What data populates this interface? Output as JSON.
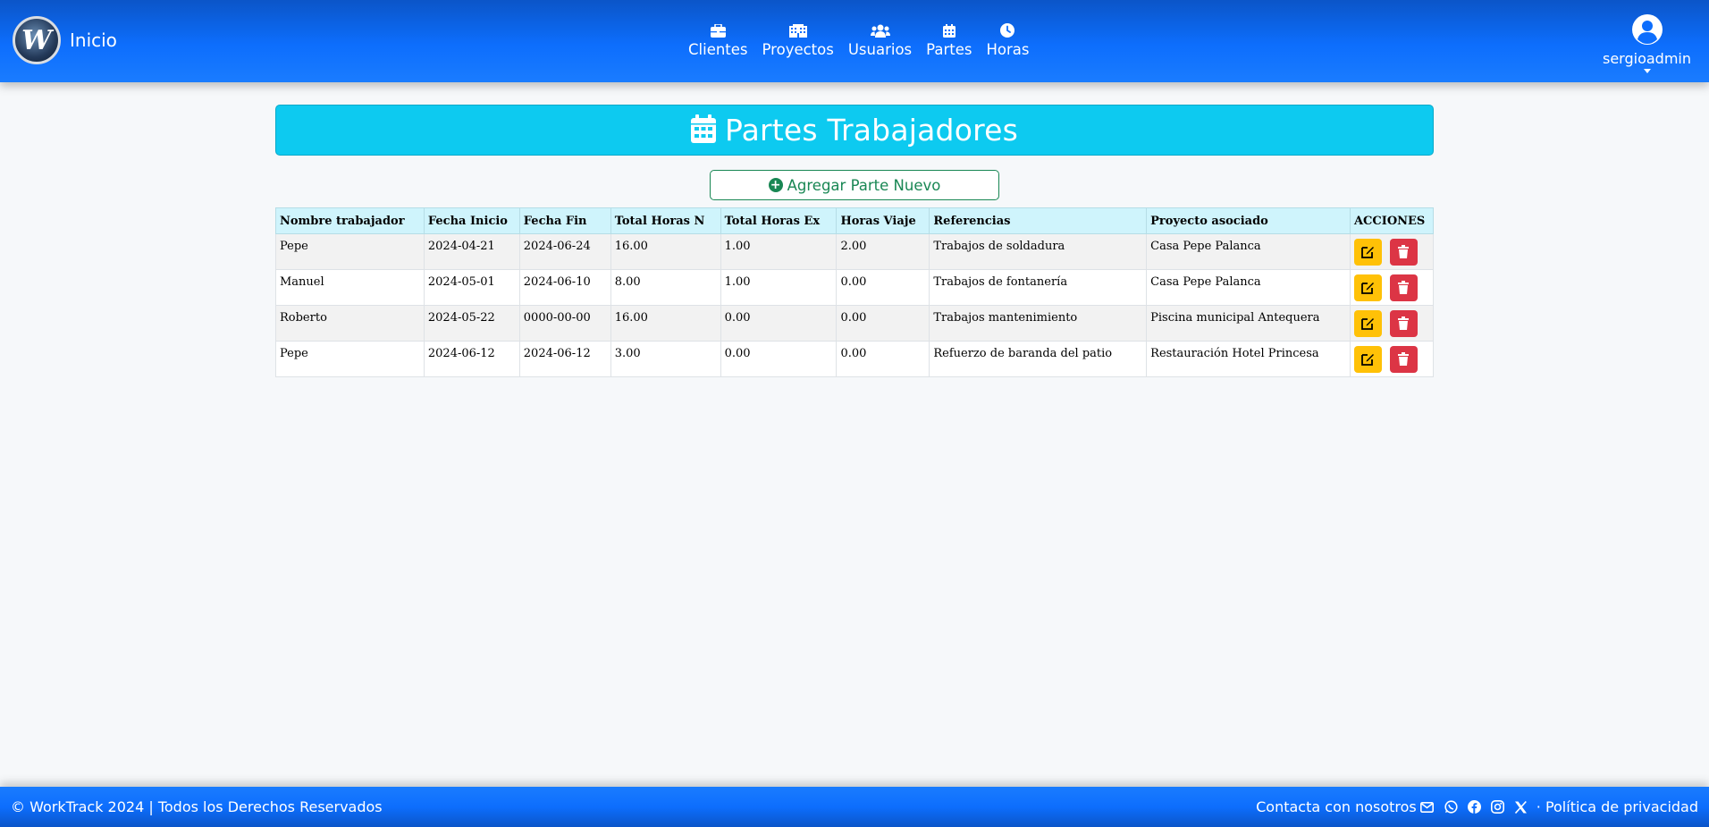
{
  "header": {
    "brand_label": "Inicio",
    "logo_letter": "W",
    "nav": [
      {
        "label": "Clientes",
        "icon": "briefcase-icon"
      },
      {
        "label": "Proyectos",
        "icon": "building-icon"
      },
      {
        "label": "Usuarios",
        "icon": "users-icon"
      },
      {
        "label": "Partes",
        "icon": "calendar-icon"
      },
      {
        "label": "Horas",
        "icon": "clock-icon"
      }
    ],
    "user": {
      "name": "sergioadmin",
      "icon": "user-circle-icon"
    }
  },
  "page": {
    "title": "Partes Trabajadores",
    "add_button": "Agregar Parte Nuevo"
  },
  "table": {
    "columns": [
      "Nombre trabajador",
      "Fecha Inicio",
      "Fecha Fin",
      "Total Horas N",
      "Total Horas Ex",
      "Horas Viaje",
      "Referencias",
      "Proyecto asociado",
      "ACCIONES"
    ],
    "rows": [
      [
        "Pepe",
        "2024-04-21",
        "2024-06-24",
        "16.00",
        "1.00",
        "2.00",
        "Trabajos de soldadura",
        "Casa Pepe Palanca"
      ],
      [
        "Manuel",
        "2024-05-01",
        "2024-06-10",
        "8.00",
        "1.00",
        "0.00",
        "Trabajos de fontanería",
        "Casa Pepe Palanca"
      ],
      [
        "Roberto",
        "2024-05-22",
        "0000-00-00",
        "16.00",
        "0.00",
        "0.00",
        "Trabajos mantenimiento",
        "Piscina municipal Antequera"
      ],
      [
        "Pepe",
        "2024-06-12",
        "2024-06-12",
        "3.00",
        "0.00",
        "0.00",
        "Refuerzo de baranda del patio",
        "Restauración Hotel Princesa"
      ]
    ]
  },
  "footer": {
    "copyright": "© WorkTrack 2024 | Todos los Derechos Reservados",
    "contact": "Contacta con nosotros",
    "privacy": "· Política de privacidad"
  },
  "colors": {
    "header_blue": "#0d6efd",
    "banner_cyan": "#0dcaf0",
    "add_green": "#198754",
    "edit_yellow": "#ffc107",
    "delete_red": "#dc3545"
  }
}
